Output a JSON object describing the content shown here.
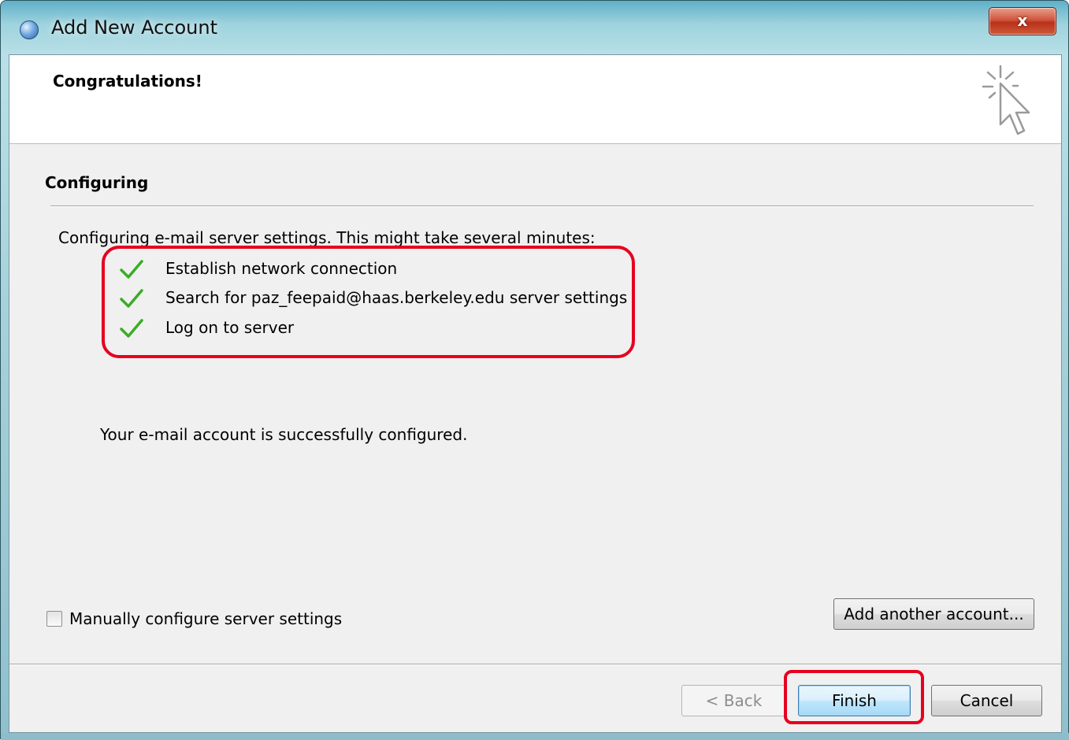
{
  "window": {
    "title": "Add New Account",
    "close_label": "x"
  },
  "header": {
    "title": "Congratulations!"
  },
  "section": {
    "title": "Configuring",
    "intro": "Configuring e-mail server settings. This might take several minutes:"
  },
  "steps": [
    {
      "label": "Establish network connection",
      "status": "done",
      "icon": "check-icon"
    },
    {
      "label": "Search for paz_feepaid@haas.berkeley.edu server settings",
      "status": "done",
      "icon": "check-icon"
    },
    {
      "label": "Log on to server",
      "status": "done",
      "icon": "check-icon"
    }
  ],
  "result": {
    "message": "Your e-mail account is successfully configured."
  },
  "options": {
    "manual_config_label": "Manually configure server settings",
    "manual_config_checked": false,
    "add_account_label": "Add another account..."
  },
  "footer": {
    "back_label": "< Back",
    "finish_label": "Finish",
    "cancel_label": "Cancel"
  },
  "colors": {
    "highlight": "#e6001f",
    "check": "#3aad26",
    "dialog_bg": "#f0f0f0"
  }
}
